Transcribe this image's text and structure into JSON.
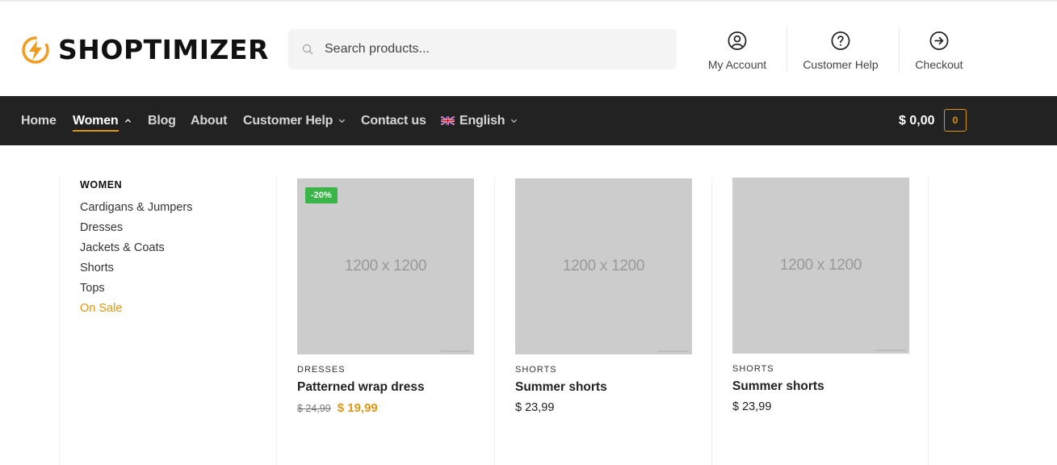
{
  "header": {
    "logo_text": "SHOPTIMIZER",
    "search": {
      "placeholder": "Search products..."
    },
    "actions": [
      {
        "label": "My Account",
        "icon": "user-circle-icon"
      },
      {
        "label": "Customer Help",
        "icon": "question-circle-icon"
      },
      {
        "label": "Checkout",
        "icon": "arrow-circle-right-icon"
      }
    ]
  },
  "nav": {
    "items": [
      {
        "label": "Home"
      },
      {
        "label": "Women",
        "active": true,
        "expanded": true
      },
      {
        "label": "Blog"
      },
      {
        "label": "About"
      },
      {
        "label": "Customer Help",
        "has_dropdown": true
      },
      {
        "label": "Contact us"
      },
      {
        "label": "English",
        "has_dropdown": true,
        "icon": "uk-flag-icon"
      }
    ],
    "cart": {
      "total": "$ 0,00",
      "count": "0"
    }
  },
  "mega_menu": {
    "heading": "WOMEN",
    "links": [
      "Cardigans & Jumpers",
      "Dresses",
      "Jackets & Coats",
      "Shorts",
      "Tops",
      "On Sale"
    ],
    "products": [
      {
        "placeholder": "1200 x 1200",
        "badge": "-20%",
        "category": "DRESSES",
        "name": "Patterned wrap dress",
        "old_price": "$ 24,99",
        "price": "$ 19,99"
      },
      {
        "placeholder": "1200 x 1200",
        "category": "SHORTS",
        "name": "Summer shorts",
        "price": "$ 23,99"
      },
      {
        "placeholder": "1200 x 1200",
        "category": "SHORTS",
        "name": "Summer shorts",
        "price": "$ 23,99"
      }
    ]
  },
  "colors": {
    "accent": "#dc9814",
    "nav_bg": "#222222",
    "badge_green": "#3bb54a",
    "placeholder_gray": "#cccccc"
  }
}
